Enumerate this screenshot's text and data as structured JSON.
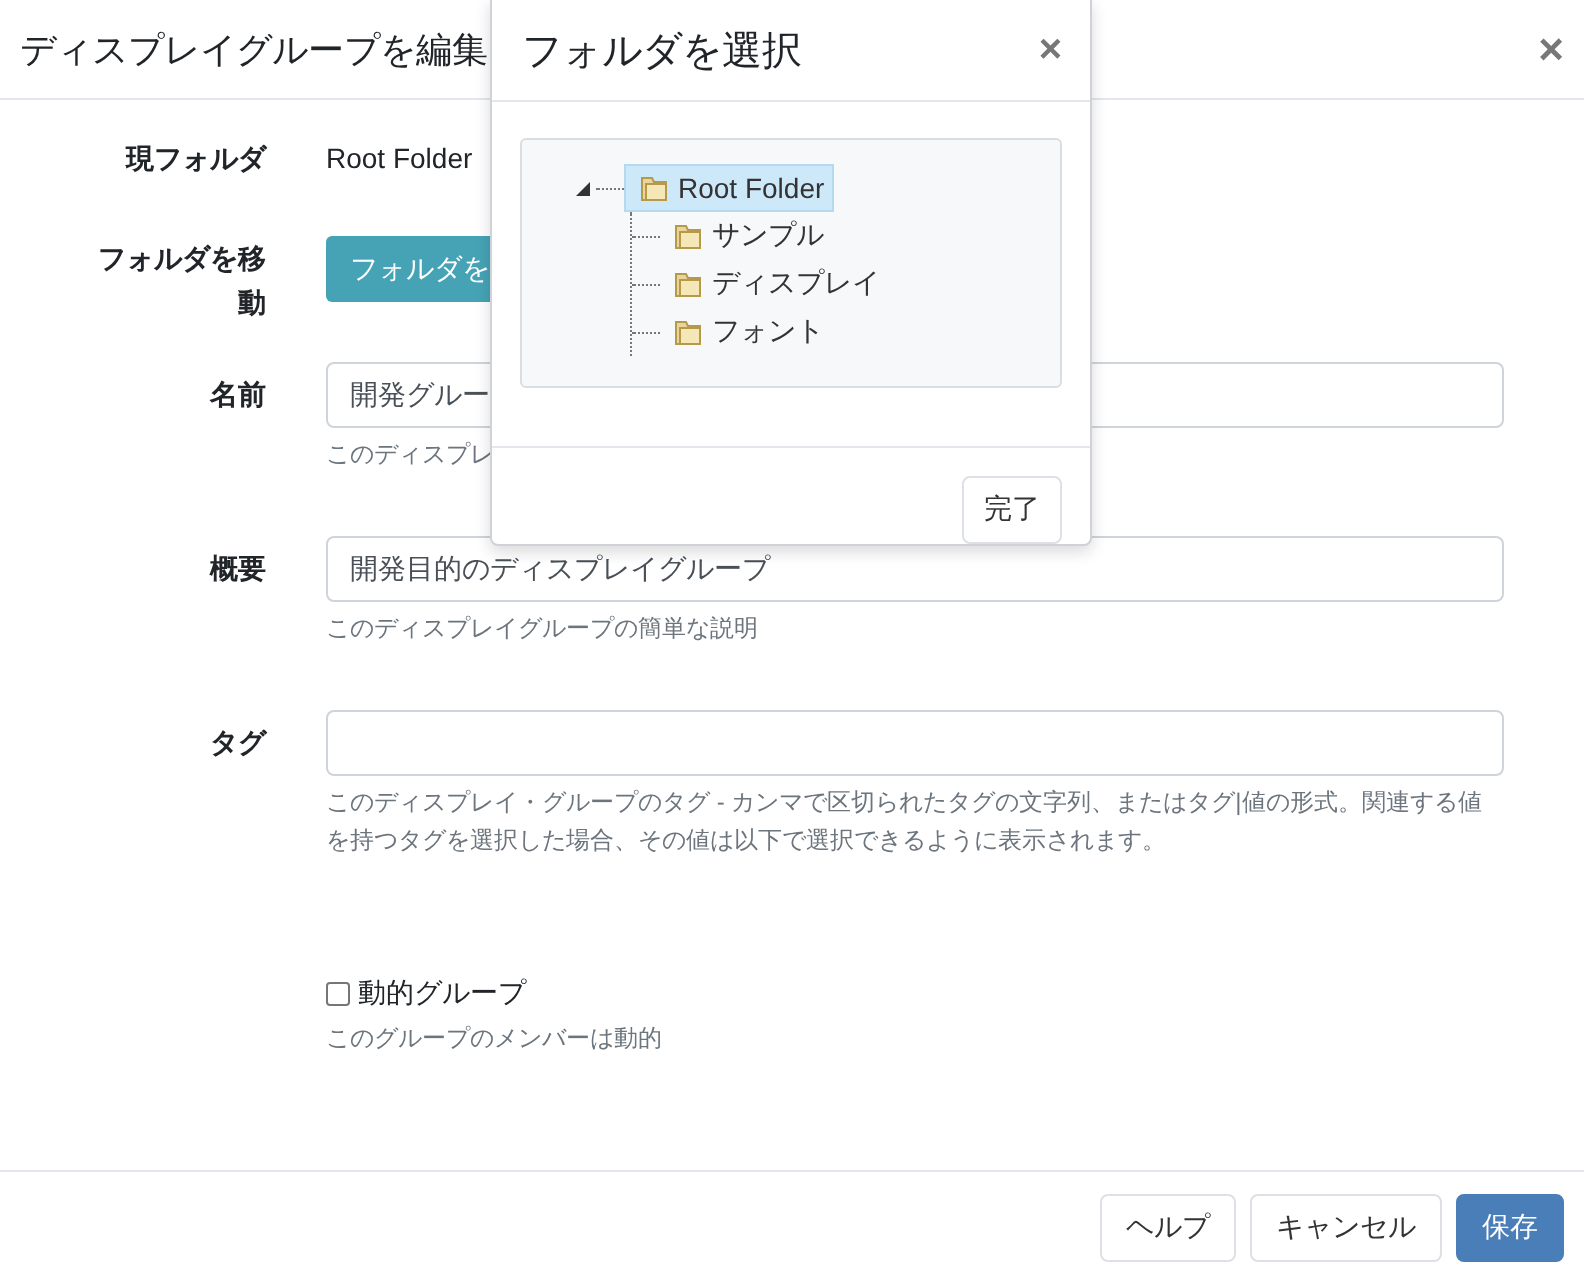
{
  "modal": {
    "title": "ディスプレイグループを編集",
    "close": "×",
    "fields": [
      {
        "kind": "text",
        "label": "現フォルダ",
        "value": "Root Folder"
      },
      {
        "kind": "button",
        "label": "フォルダを移動",
        "button": "フォルダを"
      },
      {
        "kind": "input",
        "label": "名前",
        "value": "開発グルー",
        "help": "このディスプレ"
      },
      {
        "kind": "input",
        "label": "概要",
        "value": "開発目的のディスプレイグループ",
        "help": "このディスプレイグループの簡単な説明"
      },
      {
        "kind": "input",
        "label": "タグ",
        "help": "このディスプレイ・グループのタグ - カンマで区切られたタグの文字列、またはタグ|値の形式。関連する値を持つタグを選択した場合、その値は以下で選択できるように表示されます。"
      },
      {
        "kind": "checkbox",
        "label": "動的グループ",
        "checked": false,
        "help": "このグループのメンバーは動的"
      }
    ],
    "buttons": [
      {
        "label": "ヘルプ",
        "kind": "default"
      },
      {
        "label": "キャンセル",
        "kind": "default"
      },
      {
        "label": "保存",
        "kind": "primary"
      }
    ]
  },
  "dialog": {
    "title": "フォルダを選択",
    "close": "×",
    "tree": [
      {
        "label": "Root Folder",
        "selected": true,
        "expanded": true,
        "children": [
          {
            "label": "サンプル",
            "selected": false
          },
          {
            "label": "ディスプレイ",
            "selected": false
          },
          {
            "label": "フォント",
            "selected": false
          }
        ]
      }
    ],
    "done": "完了"
  }
}
